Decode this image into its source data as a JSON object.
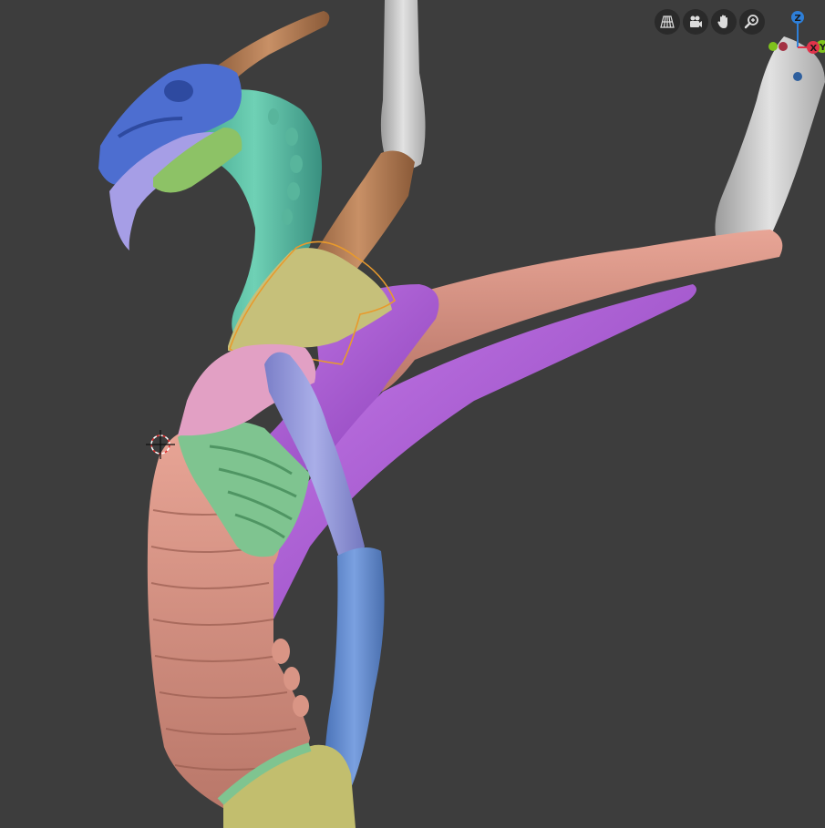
{
  "app": {
    "name": "3D viewport"
  },
  "navigation": [
    {
      "name": "toggle-perspective-button",
      "icon": "grid-perspective-icon"
    },
    {
      "name": "camera-view-button",
      "icon": "camera-icon"
    },
    {
      "name": "pan-view-button",
      "icon": "hand-icon"
    },
    {
      "name": "zoom-view-button",
      "icon": "zoom-icon"
    }
  ],
  "gizmo": {
    "z_label": "Z",
    "x_label": "X",
    "y_label": "Y",
    "colors": {
      "z": "#2e7fd8",
      "x": "#e0334a",
      "y": "#7fc21c"
    }
  },
  "scene": {
    "description_parts": [
      "skull",
      "horn",
      "neck",
      "ribcage",
      "spine",
      "upper-arm",
      "forearm",
      "wing-bones",
      "wing-membrane",
      "pelvis",
      "shoulder-blade",
      "selection-outline",
      "3d-cursor"
    ]
  }
}
